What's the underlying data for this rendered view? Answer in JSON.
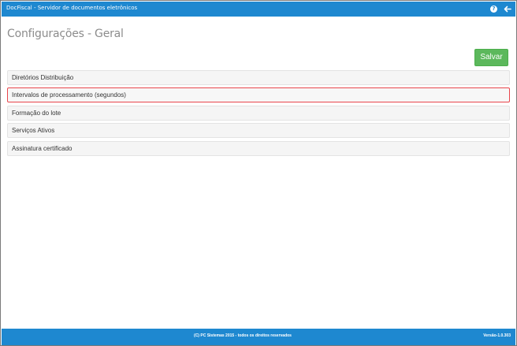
{
  "topbar": {
    "title": "DocFiscal - Servidor de documentos eletrônicos",
    "help_icon": "question-circle-icon",
    "help_glyph": "?",
    "back_icon": "arrow-left-icon"
  },
  "page": {
    "title": "Configurações - Geral"
  },
  "toolbar": {
    "save_label": "Salvar"
  },
  "sections": [
    {
      "label": "Diretórios Distribuição",
      "selected": false
    },
    {
      "label": "Intervalos de processamento (segundos)",
      "selected": true
    },
    {
      "label": "Formação do lote",
      "selected": false
    },
    {
      "label": "Serviços Ativos",
      "selected": false
    },
    {
      "label": "Assinatura certificado",
      "selected": false
    }
  ],
  "footer": {
    "copyright": "(C) PC Sistemas 2015 - todos os direitos reservados",
    "version": "Versão-1.0.303"
  },
  "colors": {
    "header_bg": "#1e88d0",
    "save_button_bg": "#5cb85c",
    "selected_border": "#e8454b",
    "section_bg": "#f5f5f5"
  }
}
